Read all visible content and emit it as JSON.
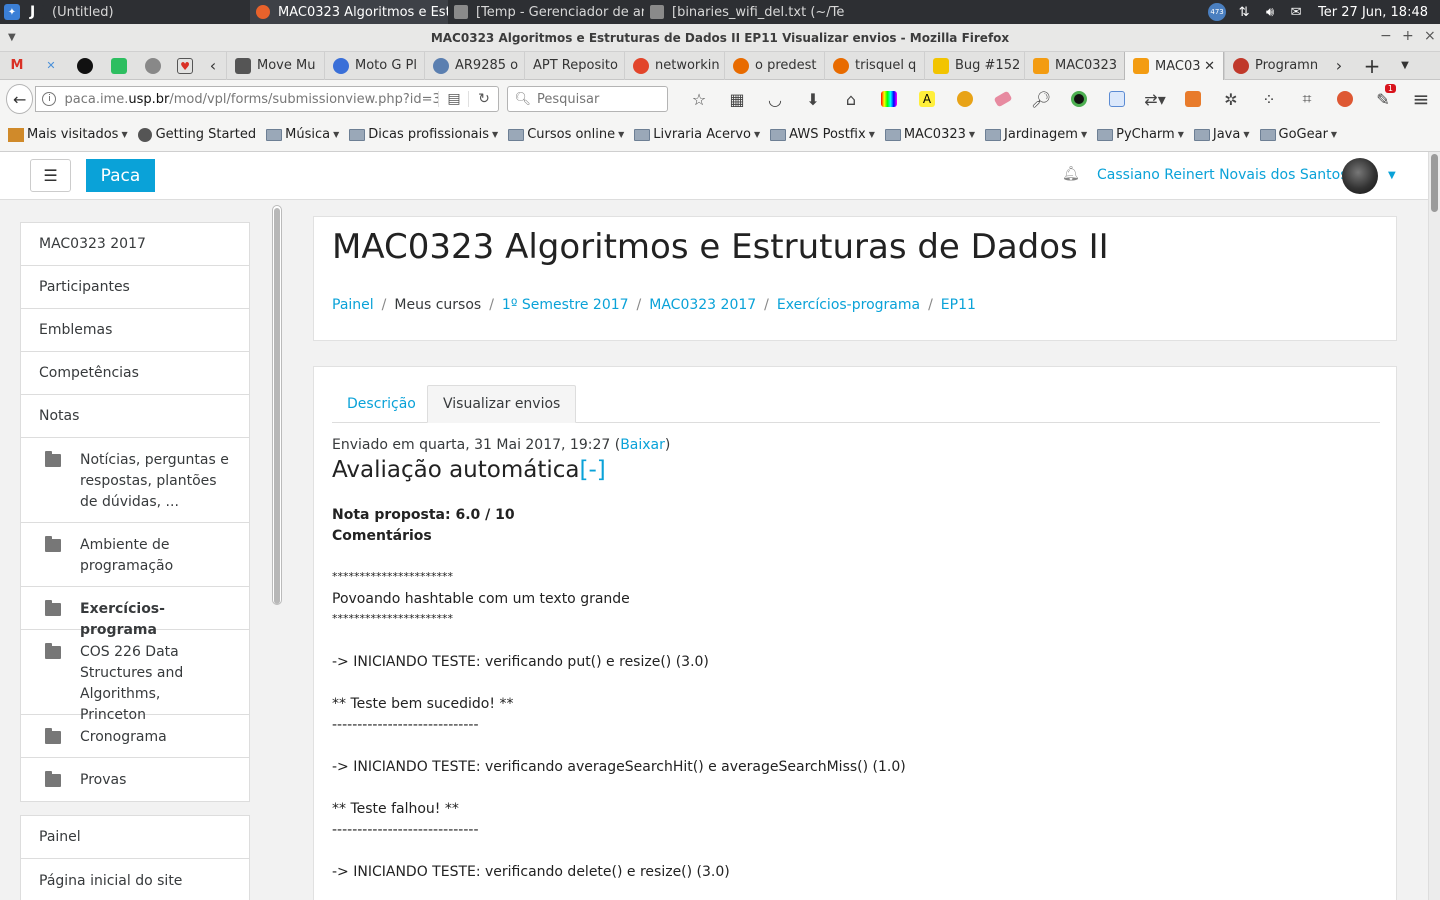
{
  "system": {
    "window_tasks": [
      {
        "label": "(Untitled)",
        "color": "#2d2f33",
        "active": false
      },
      {
        "label": "MAC0323 Algoritmos e Est...",
        "color": "#e8622b",
        "active": true
      },
      {
        "label": "[Temp - Gerenciador de ar...",
        "color": "#8a8a8a",
        "active": false
      },
      {
        "label": "[binaries_wifi_del.txt (~/Te...",
        "color": "#8a8a8a",
        "active": false
      }
    ],
    "tray_badge": "473",
    "clock": "Ter 27 Jun, 18:48"
  },
  "window": {
    "title": "MAC0323 Algoritmos e Estruturas de Dados II EP11 Visualizar envios - Mozilla Firefox"
  },
  "tabs": [
    {
      "label": "Move Mu",
      "color": "#555555"
    },
    {
      "label": "Moto G Pl",
      "color": "#3a6fd8"
    },
    {
      "label": "AR9285 o",
      "color": "#5b7fb0"
    },
    {
      "label": "APT Reposito",
      "color": "#ffffff"
    },
    {
      "label": "networkin",
      "color": "#e2452b"
    },
    {
      "label": "o predest",
      "color": "#e86b00"
    },
    {
      "label": "trisquel q",
      "color": "#e86b00"
    },
    {
      "label": "Bug #152",
      "color": "#f2c400"
    },
    {
      "label": "MAC0323",
      "color": "#f39c12"
    },
    {
      "label": "MAC03",
      "color": "#f39c12",
      "selected": true
    },
    {
      "label": "Programn",
      "color": "#c0392b"
    }
  ],
  "nav": {
    "url_host": "paca.ime.",
    "url_domain": "usp.br",
    "url_path": "/mod/vpl/forms/submissionview.php?id=3!",
    "search_placeholder": "Pesquisar"
  },
  "bookmarks": [
    {
      "label": "Mais visitados",
      "type": "special",
      "caret": true
    },
    {
      "label": "Getting Started",
      "type": "link",
      "caret": false
    },
    {
      "label": "Música",
      "type": "folder",
      "caret": true
    },
    {
      "label": "Dicas profissionais",
      "type": "folder",
      "caret": true
    },
    {
      "label": "Cursos online",
      "type": "folder",
      "caret": true
    },
    {
      "label": "Livraria Acervo",
      "type": "folder",
      "caret": true
    },
    {
      "label": "AWS Postfix",
      "type": "folder",
      "caret": true
    },
    {
      "label": "MAC0323",
      "type": "folder",
      "caret": true
    },
    {
      "label": "Jardinagem",
      "type": "folder",
      "caret": true
    },
    {
      "label": "PyCharm",
      "type": "folder",
      "caret": true
    },
    {
      "label": "Java",
      "type": "folder",
      "caret": true
    },
    {
      "label": "GoGear",
      "type": "folder",
      "caret": true
    }
  ],
  "moodle": {
    "brand": "Paca",
    "username": "Cassiano Reinert Novais dos Santos",
    "nav_main": [
      {
        "label": "MAC0323 2017"
      },
      {
        "label": "Participantes"
      },
      {
        "label": "Emblemas"
      },
      {
        "label": "Competências"
      },
      {
        "label": "Notas"
      }
    ],
    "nav_sections": [
      {
        "label": "Notícias, perguntas e respostas, plantões de dúvidas, ...",
        "bold": false
      },
      {
        "label": "Ambiente de programação",
        "bold": false
      },
      {
        "label": "Exercícios-programa",
        "bold": true
      },
      {
        "label": "COS 226 Data Structures and Algorithms, Princeton",
        "bold": false
      },
      {
        "label": "Cronograma",
        "bold": false
      },
      {
        "label": "Provas",
        "bold": false
      }
    ],
    "nav_site": [
      {
        "label": "Painel"
      },
      {
        "label": "Página inicial do site"
      }
    ],
    "course_title": "MAC0323 Algoritmos e Estruturas de Dados II",
    "breadcrumb": [
      {
        "label": "Painel",
        "link": true
      },
      {
        "label": "Meus cursos",
        "link": false
      },
      {
        "label": "1º Semestre 2017",
        "link": true
      },
      {
        "label": "MAC0323 2017",
        "link": true
      },
      {
        "label": "Exercícios-programa",
        "link": true
      },
      {
        "label": "EP11",
        "link": true
      }
    ],
    "tabs": [
      {
        "label": "Descrição",
        "active": false
      },
      {
        "label": "Visualizar envios",
        "active": true
      }
    ],
    "submitted_text": "Enviado em quarta, 31 Mai 2017, 19:27 (",
    "download_link": "Baixar",
    "submitted_close": ")",
    "eval_heading": "Avaliação automática",
    "eval_toggle": "[-]",
    "proposed_grade": "Nota proposta: 6.0 / 10",
    "comments_heading": "Comentários",
    "log_lines": [
      {
        "text": "**********************",
        "small": true
      },
      {
        "text": "Povoando hashtable com um texto grande",
        "small": false
      },
      {
        "text": "**********************",
        "small": true
      },
      {
        "text": "-> INICIANDO TESTE: verificando put() e resize() (3.0)",
        "small": false
      },
      {
        "text": "** Teste bem sucedido! **",
        "small": false
      },
      {
        "text": "-----------------------------",
        "small": false
      },
      {
        "text": "-> INICIANDO TESTE: verificando averageSearchHit() e averageSearchMiss() (1.0)",
        "small": false
      },
      {
        "text": "** Teste falhou! **",
        "small": false
      },
      {
        "text": "-----------------------------",
        "small": false
      },
      {
        "text": "-> INICIANDO TESTE: verificando delete() e resize() (3.0)",
        "small": false
      }
    ]
  }
}
